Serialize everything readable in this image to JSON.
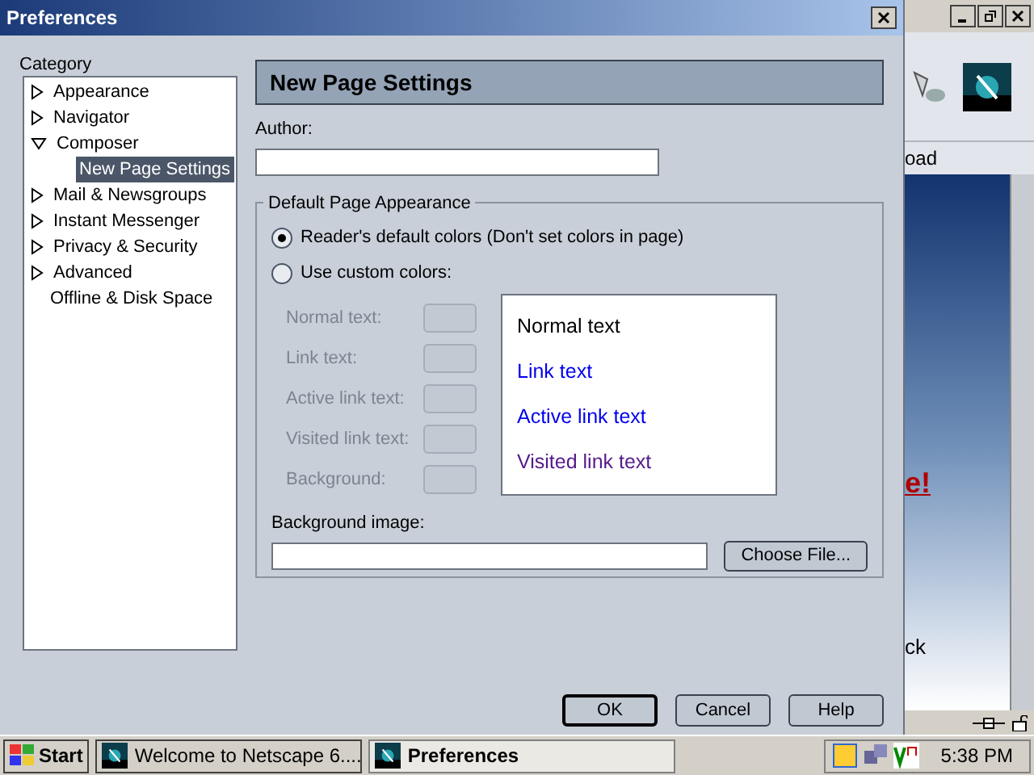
{
  "dialog": {
    "title": "Preferences",
    "category_label": "Category",
    "categories": [
      {
        "label": "Appearance",
        "kind": "collapsed",
        "selected": false
      },
      {
        "label": "Navigator",
        "kind": "collapsed",
        "selected": false
      },
      {
        "label": "Composer",
        "kind": "expanded",
        "selected": false,
        "children": [
          {
            "label": "New Page Settings",
            "selected": true
          }
        ]
      },
      {
        "label": "Mail & Newsgroups",
        "kind": "collapsed",
        "selected": false
      },
      {
        "label": "Instant Messenger",
        "kind": "collapsed",
        "selected": false
      },
      {
        "label": "Privacy & Security",
        "kind": "collapsed",
        "selected": false
      },
      {
        "label": "Advanced",
        "kind": "collapsed",
        "selected": false
      },
      {
        "label": "Offline & Disk Space",
        "kind": "leaf",
        "selected": false
      }
    ],
    "panel_title": "New Page Settings",
    "author_label": "Author:",
    "group_label": "Default Page Appearance",
    "radios": [
      {
        "label": "Reader's default colors (Don't set colors in page)",
        "selected": true
      },
      {
        "label": "Use custom colors:",
        "selected": false
      }
    ],
    "color_rows": [
      {
        "label": "Normal text:",
        "disabled": true
      },
      {
        "label": "Link text:",
        "disabled": true
      },
      {
        "label": "Active link text:",
        "disabled": true
      },
      {
        "label": "Visited link text:",
        "disabled": true
      },
      {
        "label": "Background:",
        "disabled": true
      }
    ],
    "preview": [
      {
        "text": "Normal text",
        "color": "#000000"
      },
      {
        "text": "Link text",
        "color": "#0000ee"
      },
      {
        "text": "Active link text",
        "color": "#0000ee"
      },
      {
        "text": "Visited link text",
        "color": "#551a8b"
      }
    ],
    "background_image_label": "Background image:",
    "choose_button": "Choose File...",
    "buttons": [
      {
        "label": "OK",
        "default": true
      },
      {
        "label": "Cancel",
        "default": false
      },
      {
        "label": "Help",
        "default": false
      }
    ]
  },
  "browser": {
    "tab_fragment": "oad",
    "headline_fragment": "e!",
    "text_fragment": "ck"
  },
  "taskbar": {
    "start": "Start",
    "tasks": [
      {
        "label": "Welcome to Netscape 6....",
        "selected": false
      },
      {
        "label": "Preferences",
        "selected": true
      }
    ],
    "clock": "5:38 PM"
  }
}
